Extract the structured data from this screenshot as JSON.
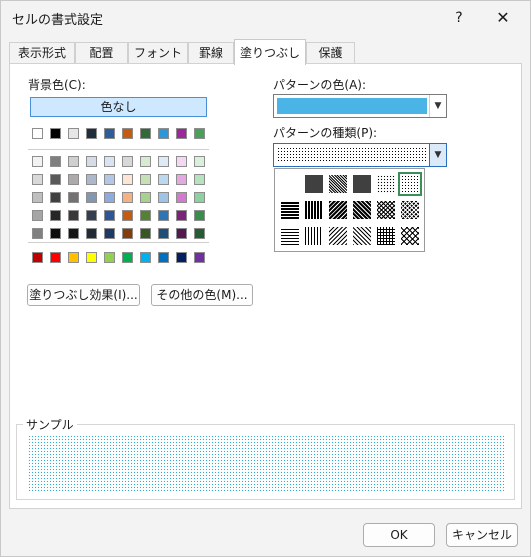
{
  "window": {
    "title": "セルの書式設定",
    "help_glyph": "?",
    "close_glyph": "✕"
  },
  "tabs": [
    {
      "label": "表示形式"
    },
    {
      "label": "配置"
    },
    {
      "label": "フォント"
    },
    {
      "label": "罫線"
    },
    {
      "label": "塗りつぶし",
      "selected": true
    },
    {
      "label": "保護"
    }
  ],
  "fill": {
    "bg_color_label": "背景色(C):",
    "no_color_label": "色なし",
    "fill_effects_button": "塗りつぶし効果(I)...",
    "more_colors_button": "その他の色(M)...",
    "theme_top_row": [
      "#ffffff",
      "#000000",
      "#e7e6e6",
      "#1f2d3d",
      "#2e5d9a",
      "#c55a11",
      "#2f6b38",
      "#2e98d6",
      "#9a2a9a",
      "#4aa05a"
    ],
    "theme_shades": [
      [
        "#f2f2f2",
        "#7f7f7f",
        "#d0cece",
        "#d6dce4",
        "#dae3f3",
        "#d8d8d8",
        "#d9ead3",
        "#ddebf7",
        "#f4d7f2",
        "#d8f0dc"
      ],
      [
        "#d9d9d9",
        "#595959",
        "#aeaaaa",
        "#adb9ca",
        "#b4c7e7",
        "#fbe5d6",
        "#c5e0b4",
        "#bdd7ee",
        "#e4a9e1",
        "#b6e2bf"
      ],
      [
        "#bfbfbf",
        "#404040",
        "#757171",
        "#8497b0",
        "#8faadc",
        "#f4b183",
        "#a9d18e",
        "#9dc3e6",
        "#d07ccd",
        "#8fd19e"
      ],
      [
        "#a6a6a6",
        "#262626",
        "#3a3838",
        "#333f50",
        "#2f5597",
        "#c55a11",
        "#548235",
        "#2e75b6",
        "#7a2378",
        "#3a8b4c"
      ],
      [
        "#808080",
        "#0d0d0d",
        "#171616",
        "#222a35",
        "#203864",
        "#843c0c",
        "#385723",
        "#1f4e79",
        "#511851",
        "#265c33"
      ]
    ],
    "standard_colors": [
      "#c00000",
      "#ff0000",
      "#ffc000",
      "#ffff00",
      "#92d050",
      "#00b050",
      "#00b0f0",
      "#0070c0",
      "#002060",
      "#7030a0"
    ]
  },
  "pattern": {
    "color_label": "パターンの色(A):",
    "color_value": "#4bb4e6",
    "style_label": "パターンの種類(P):",
    "style_value": "12.5% gray"
  },
  "sample": {
    "label": "サンプル",
    "pattern_color": "#33a9d8"
  },
  "footer": {
    "ok_label": "OK",
    "cancel_label": "キャンセル"
  }
}
